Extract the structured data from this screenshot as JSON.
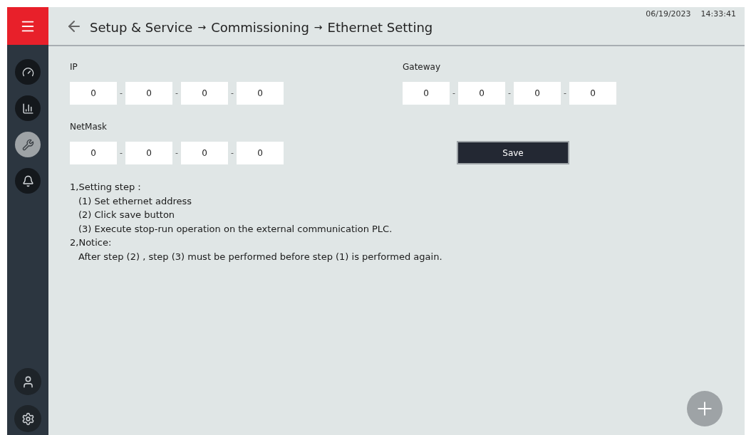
{
  "header": {
    "breadcrumb": [
      "Setup & Service",
      "Commissioning",
      "Ethernet Setting"
    ],
    "separator": "→",
    "date": "06/19/2023",
    "time": "14:33:41"
  },
  "sidebar": {
    "items": [
      {
        "kind": "gauge",
        "selected": false
      },
      {
        "kind": "chart",
        "selected": false
      },
      {
        "kind": "wrench",
        "selected": true
      },
      {
        "kind": "bell",
        "selected": false
      }
    ],
    "bottom": [
      {
        "kind": "user"
      },
      {
        "kind": "gear"
      }
    ]
  },
  "fields": [
    {
      "label": "IP",
      "octets": [
        "0",
        "0",
        "0",
        "0"
      ]
    },
    {
      "label": "Gateway",
      "octets": [
        "0",
        "0",
        "0",
        "0"
      ]
    },
    {
      "label": "NetMask",
      "octets": [
        "0",
        "0",
        "0",
        "0"
      ]
    }
  ],
  "octet_separator": "-",
  "save_button": "Save",
  "instructions": [
    {
      "text": "1,Setting step：",
      "indent": false
    },
    {
      "text": "(1) Set ethernet address",
      "indent": true
    },
    {
      "text": "(2) Click save button",
      "indent": true
    },
    {
      "text": "(3) Execute stop-run operation on the external communication PLC.",
      "indent": true
    },
    {
      "text": "2,Notice:",
      "indent": false
    },
    {
      "text": "After step (2) , step (3) must be performed before step (1) is performed again.",
      "indent": true
    }
  ]
}
